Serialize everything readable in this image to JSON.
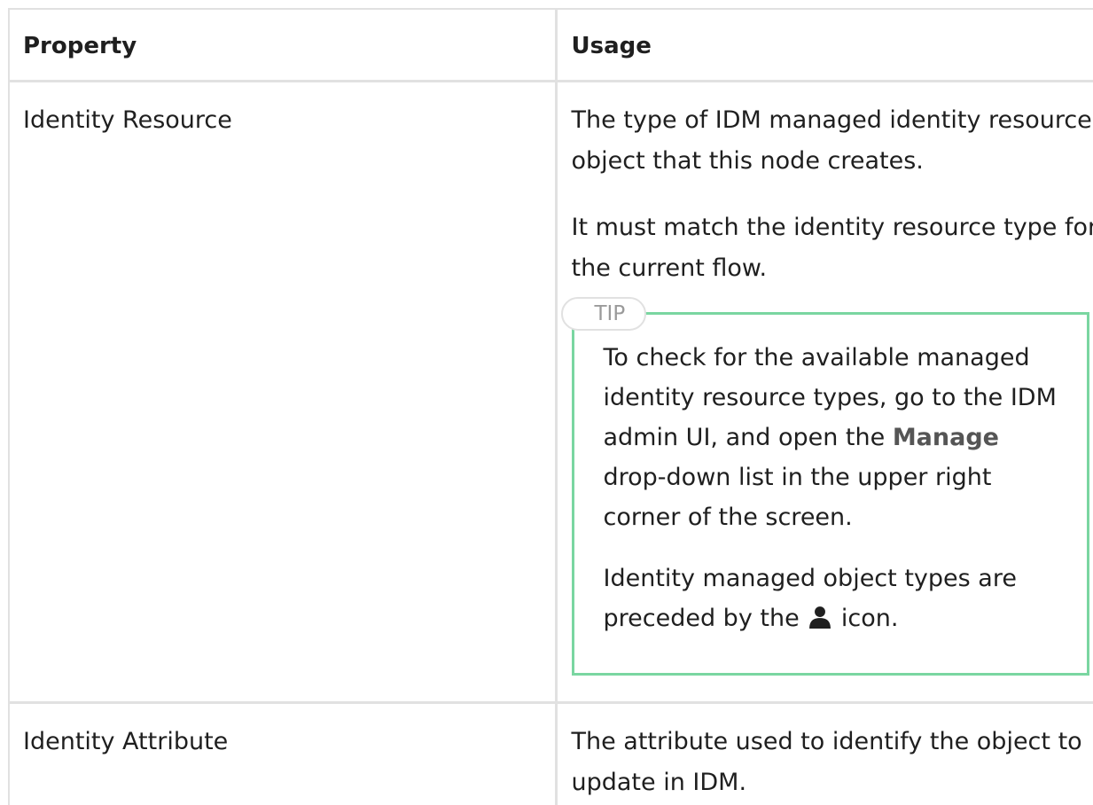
{
  "table": {
    "headers": {
      "property": "Property",
      "usage": "Usage"
    },
    "rows": [
      {
        "property": "Identity Resource",
        "usage_paragraphs": [
          "The type of IDM managed identity resource object that this node creates.",
          "It must match the identity resource type for the current flow."
        ],
        "tip": {
          "label": "TIP",
          "text1_before": "To check for the available managed identity resource types, go to the IDM admin UI, and open the ",
          "text1_bold": "Manage",
          "text1_after": " drop-down list in the upper right corner of the screen.",
          "text2_before": "Identity managed object types are preceded by the ",
          "text2_icon": "user-icon",
          "text2_after": " icon."
        }
      },
      {
        "property": "Identity Attribute",
        "usage_paragraphs": [
          "The attribute used to identify the object to update in IDM."
        ]
      }
    ]
  },
  "colors": {
    "border": "#e1e1e1",
    "tip_border": "#7ad6a1",
    "tip_label": "#9a9a9a"
  }
}
